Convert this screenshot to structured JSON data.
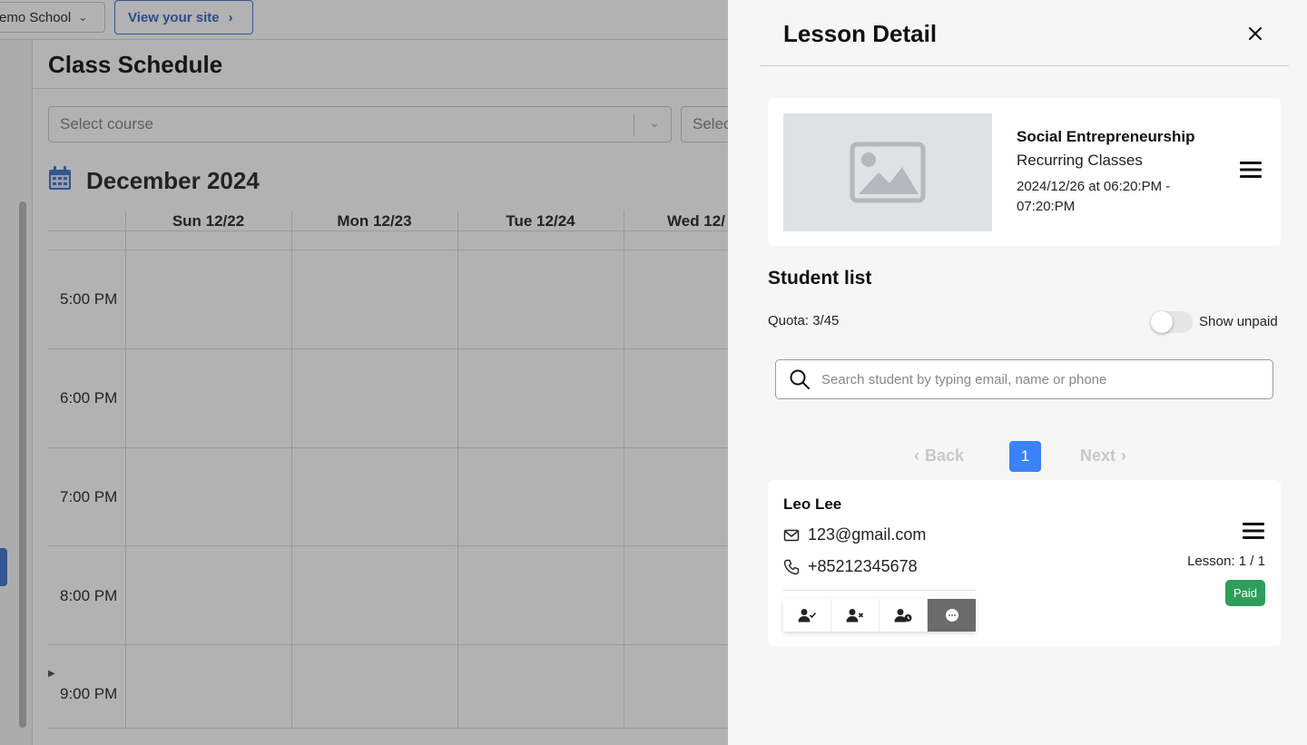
{
  "topbar": {
    "school_label": "emo School",
    "view_site_label": "View your site"
  },
  "schedule": {
    "title": "Class Schedule",
    "course_placeholder": "Select course",
    "second_select_text": "Selec",
    "month": "December 2024",
    "days": [
      "Sun 12/22",
      "Mon 12/23",
      "Tue 12/24",
      "Wed 12/"
    ],
    "times": [
      "5:00 PM",
      "6:00 PM",
      "7:00 PM",
      "8:00 PM",
      "9:00 PM"
    ]
  },
  "drawer": {
    "title": "Lesson Detail",
    "lesson": {
      "name": "Social Entrepreneurship",
      "type": "Recurring Classes",
      "time": "2024/12/26 at 06:20:PM - 07:20:PM"
    },
    "student_list_title": "Student list",
    "quota": "Quota: 3/45",
    "show_unpaid_label": "Show unpaid",
    "show_unpaid_on": false,
    "search_placeholder": "Search student by typing email, name or phone",
    "pager": {
      "back": "Back",
      "current_page": "1",
      "next": "Next"
    },
    "students": [
      {
        "name": "Leo Lee",
        "email": "123@gmail.com",
        "phone": "+85212345678",
        "lesson_count": "Lesson: 1 / 1",
        "status": "Paid"
      }
    ]
  },
  "colors": {
    "accent": "#3b82f6",
    "paid": "#2e9e5b",
    "overlay": "rgba(0,0,0,0.30)"
  }
}
